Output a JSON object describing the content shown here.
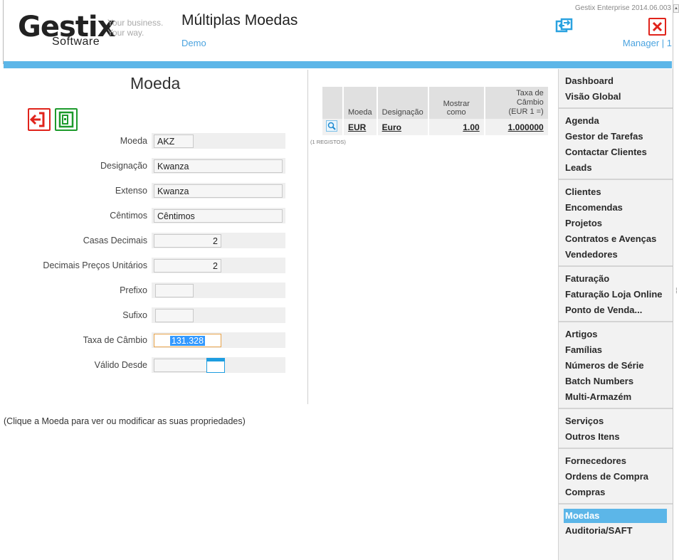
{
  "header": {
    "logo_main": "Gestix",
    "logo_sub": "Software",
    "tagline_1": "Your business.",
    "tagline_2": "Your way.",
    "title": "Múltiplas Moedas",
    "company": "Demo",
    "version": "Gestix Enterprise 2014.06.003",
    "user": "Manager | 1",
    "refresh_icon": "refresh-icon",
    "close_icon": "close-icon"
  },
  "form": {
    "title": "Moeda",
    "back_icon": "back-arrow-icon",
    "save_icon": "save-icon",
    "fields": [
      {
        "label": "Moeda",
        "value": "AKZ"
      },
      {
        "label": "Designação",
        "value": "Kwanza"
      },
      {
        "label": "Extenso",
        "value": "Kwanza"
      },
      {
        "label": "Cêntimos",
        "value": "Cêntimos"
      },
      {
        "label": "Casas Decimais",
        "value": "2"
      },
      {
        "label": "Decimais Preços Unitários",
        "value": "2"
      },
      {
        "label": "Prefixo",
        "value": ""
      },
      {
        "label": "Sufixo",
        "value": ""
      },
      {
        "label": "Taxa de Câmbio",
        "value": "131.328"
      },
      {
        "label": "Válido Desde",
        "value": ""
      }
    ],
    "help": "(Clique a Moeda para ver ou modificar as suas propriedades)"
  },
  "table": {
    "headers": [
      "Moeda",
      "Designação",
      "Mostrar como",
      "Taxa de Câmbio",
      "(EUR 1 =)"
    ],
    "rows": [
      {
        "moeda": "EUR",
        "designacao": "Euro",
        "mostrar": "1.00",
        "taxa": "1.000000"
      }
    ],
    "count": "(1 REGISTOS)"
  },
  "sidebar": {
    "groups": [
      [
        "Dashboard",
        "Visão Global"
      ],
      [
        "Agenda",
        "Gestor de Tarefas",
        "Contactar Clientes",
        "Leads"
      ],
      [
        "Clientes",
        "Encomendas",
        "Projetos",
        "Contratos e Avenças",
        "Vendedores"
      ],
      [
        "Faturação",
        "Faturação Loja Online",
        "Ponto de Venda..."
      ],
      [
        "Artigos",
        "Famílias",
        "Números de Série",
        "Batch Numbers",
        "Multi-Armazém"
      ],
      [
        "Serviços",
        "Outros Itens"
      ],
      [
        "Fornecedores",
        "Ordens de Compra",
        "Compras"
      ],
      [
        "Moedas",
        "Auditoria/SAFT"
      ]
    ],
    "active": "Moedas"
  },
  "colors": {
    "accent_blue": "#5cb6e8",
    "link_blue": "#4aa3df",
    "danger_red": "#e0231b",
    "save_green": "#1d9a2c"
  }
}
